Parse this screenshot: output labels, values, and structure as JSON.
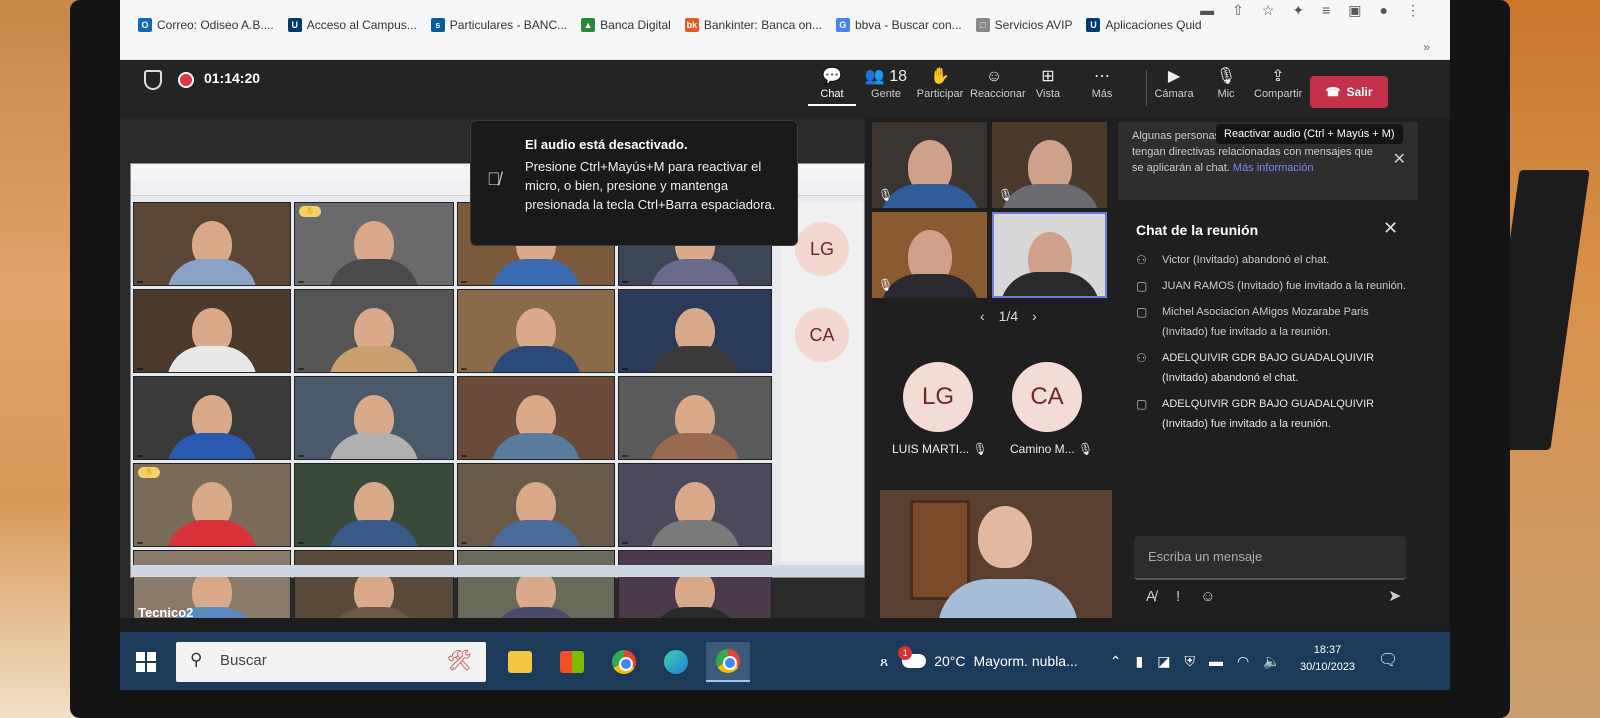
{
  "browser": {
    "bookmarks": [
      {
        "label": "Correo: Odiseo A.B....",
        "icon": "outlook-icon",
        "color": "#0f6cbd",
        "glyph": "O"
      },
      {
        "label": "Acceso al Campus...",
        "icon": "campus-icon",
        "color": "#003a70",
        "glyph": "U"
      },
      {
        "label": "Particulares - BANC...",
        "icon": "bank-icon",
        "color": "#0a5aa0",
        "glyph": "s"
      },
      {
        "label": "Banca Digital",
        "icon": "bank-digital-icon",
        "color": "#2a8a3a",
        "glyph": "▲"
      },
      {
        "label": "Bankinter: Banca on...",
        "icon": "bankinter-icon",
        "color": "#e25c1e",
        "glyph": "bk"
      },
      {
        "label": "bbva - Buscar con...",
        "icon": "google-icon",
        "color": "#4285f4",
        "glyph": "G"
      },
      {
        "label": "Servicios AVIP",
        "icon": "page-icon",
        "color": "#888888",
        "glyph": "□"
      },
      {
        "label": "Aplicaciones Quid",
        "icon": "campus-icon",
        "color": "#003a70",
        "glyph": "U"
      }
    ],
    "more": "»"
  },
  "topbar": {
    "timer": "01:14:20",
    "items": [
      {
        "label": "Chat",
        "icon": "chat-icon",
        "glyph": "💬",
        "active": true
      },
      {
        "label": "Gente",
        "icon": "people-icon",
        "glyph": "👥 18"
      },
      {
        "label": "Participar",
        "icon": "raise-hand-icon",
        "glyph": "✋"
      },
      {
        "label": "Reaccionar",
        "icon": "emoji-icon",
        "glyph": "☺"
      },
      {
        "label": "Vista",
        "icon": "view-icon",
        "glyph": "⊞"
      },
      {
        "label": "Más",
        "icon": "more-icon",
        "glyph": "⋯"
      }
    ],
    "right_items": [
      {
        "label": "Cámara",
        "icon": "camera-icon",
        "glyph": "▶"
      },
      {
        "label": "Mic",
        "icon": "mic-off-icon",
        "glyph": "🎙"
      },
      {
        "label": "Compartir",
        "icon": "share-icon",
        "glyph": "⇪"
      }
    ],
    "leave": "Salir"
  },
  "toast": {
    "title": "El audio está desactivado.",
    "body": "Presione Ctrl+Mayús+M para reactivar el micro, o bien, presione y mantenga presionada la tecla Ctrl+Barra espaciadora."
  },
  "shared_screen": {
    "tiles": [
      "",
      "",
      "",
      "",
      "",
      "",
      "",
      "",
      "",
      "",
      "",
      "",
      "",
      "",
      "",
      "",
      "",
      "",
      "",
      ""
    ],
    "side_avatars": [
      {
        "initials": "LG",
        "caption": ""
      },
      {
        "initials": "CA",
        "caption": ""
      }
    ]
  },
  "grid": {
    "pager": "1/4",
    "avatars": [
      {
        "initials": "LG",
        "name": "LUIS MARTI..."
      },
      {
        "initials": "CA",
        "name": "Camino M..."
      }
    ]
  },
  "chat": {
    "banner": "Algunas personas ... organización. Es posible que tengan directivas relacionadas con mensajes que se aplicarán al chat.",
    "banner_link": "Más información",
    "tooltip": "Reactivar audio (Ctrl + Mayús + M)",
    "title": "Chat de la reunión",
    "messages": [
      {
        "icon": "person-leave-icon",
        "text": "Victor (Invitado) abandonó el chat."
      },
      {
        "icon": "invite-icon",
        "text": "JUAN RAMOS (Invitado) fue invitado a la reunión."
      },
      {
        "icon": "invite-icon",
        "text": "Michel Asociacion AMigos Mozarabe Paris (Invitado) fue invitado a la reunión."
      },
      {
        "icon": "person-leave-icon",
        "text": "ADELQUIVIR GDR BAJO GUADALQUIVIR (Invitado) abandonó el chat."
      },
      {
        "icon": "invite-icon",
        "text": "ADELQUIVIR GDR BAJO GUADALQUIVIR (Invitado) fue invitado a la reunión."
      }
    ],
    "placeholder": "Escriba un mensaje"
  },
  "self_name": "Tecnico2",
  "taskbar": {
    "search": "Buscar",
    "weather_badge": "1",
    "temperature": "20°C",
    "weather": "Mayorm. nubla...",
    "time": "18:37",
    "date": "30/10/2023"
  }
}
